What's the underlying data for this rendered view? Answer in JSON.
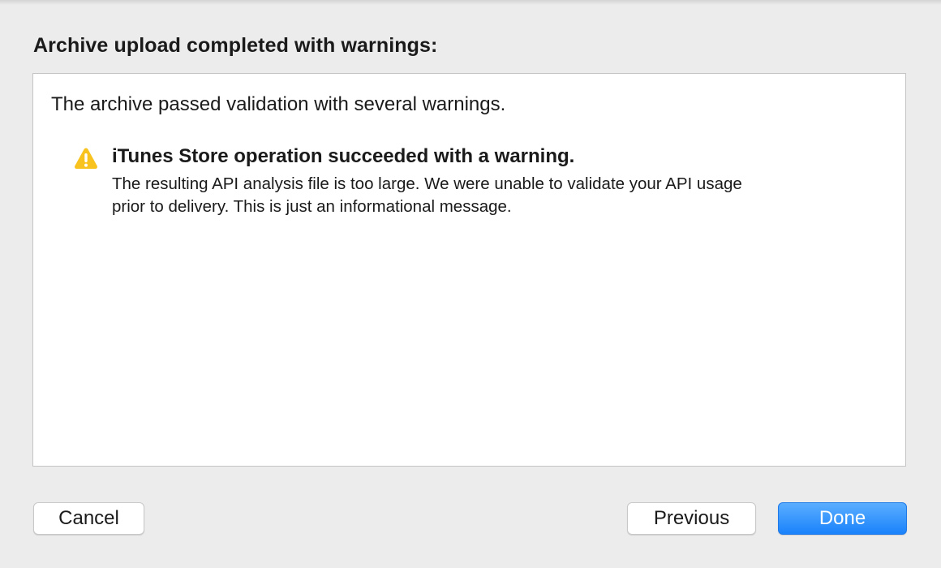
{
  "sheet": {
    "title": "Archive upload completed with warnings:"
  },
  "content": {
    "summary": "The archive passed validation with several warnings.",
    "warnings": [
      {
        "icon": "warning-triangle-icon",
        "title": "iTunes Store operation succeeded with a warning.",
        "message": "The resulting API analysis file is too large.  We were unable to validate your API usage\nprior to delivery.  This is just an informational message."
      }
    ]
  },
  "buttons": {
    "cancel_label": "Cancel",
    "previous_label": "Previous",
    "done_label": "Done"
  },
  "colors": {
    "background": "#ececec",
    "panel": "#ffffff",
    "accent": "#1a82fb",
    "warning": "#f8c21f"
  }
}
